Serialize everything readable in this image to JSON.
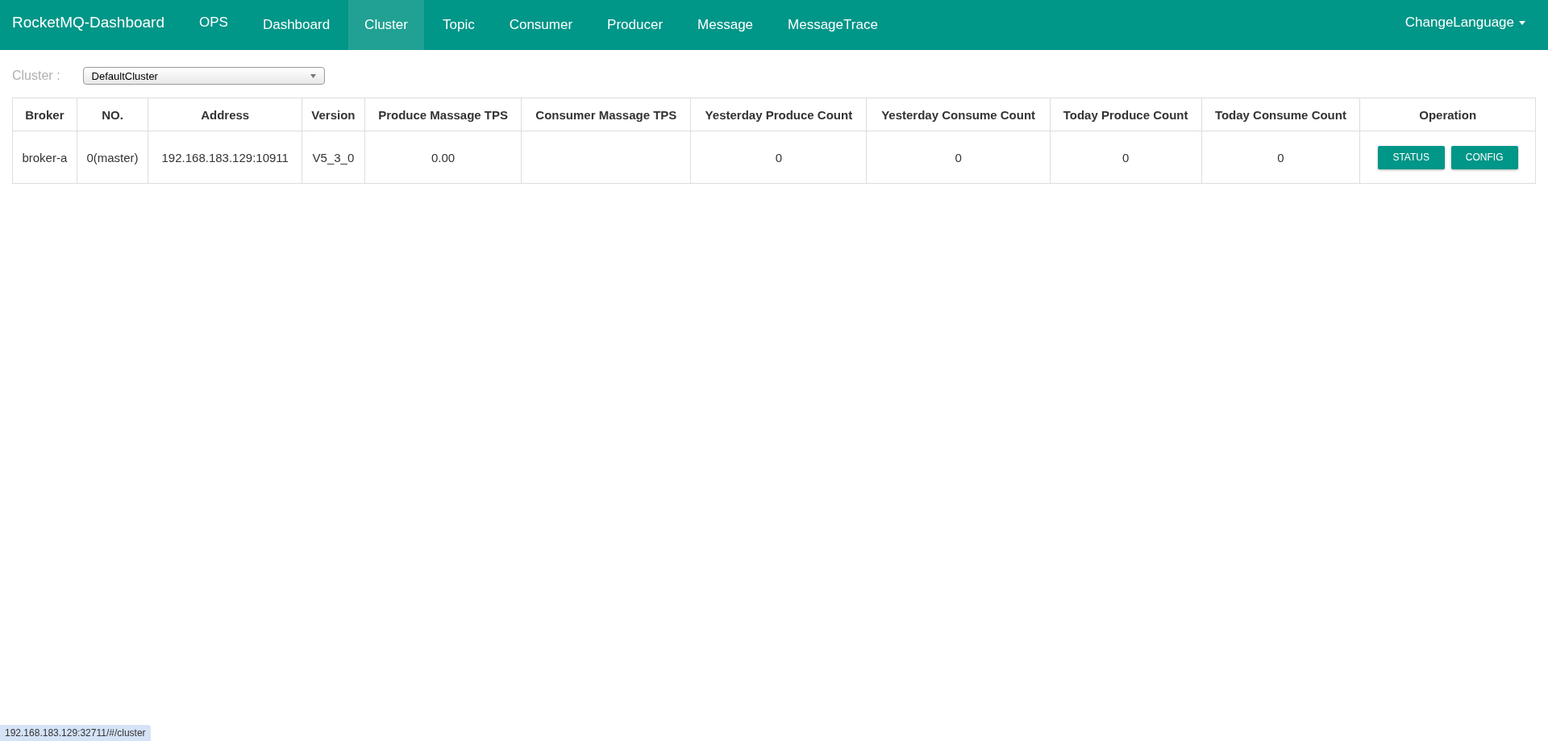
{
  "navbar": {
    "brand": "RocketMQ-Dashboard",
    "items": [
      {
        "label": "OPS",
        "selected": false
      },
      {
        "label": "Dashboard",
        "selected": false
      },
      {
        "label": "Cluster",
        "selected": true
      },
      {
        "label": "Topic",
        "selected": false
      },
      {
        "label": "Consumer",
        "selected": false
      },
      {
        "label": "Producer",
        "selected": false
      },
      {
        "label": "Message",
        "selected": false
      },
      {
        "label": "MessageTrace",
        "selected": false
      }
    ],
    "language_menu": "ChangeLanguage"
  },
  "cluster_filter": {
    "label": "Cluster :",
    "value": "DefaultCluster"
  },
  "table": {
    "columns": [
      "Broker",
      "NO.",
      "Address",
      "Version",
      "Produce Massage TPS",
      "Consumer Massage TPS",
      "Yesterday Produce Count",
      "Yesterday Consume Count",
      "Today Produce Count",
      "Today Consume Count",
      "Operation"
    ],
    "rows": [
      {
        "cells": [
          "broker-a",
          "0(master)",
          "192.168.183.129:10911",
          "V5_3_0",
          "0.00",
          "",
          "0",
          "0",
          "0",
          "0"
        ],
        "buttons": [
          "STATUS",
          "CONFIG"
        ]
      }
    ]
  },
  "status_bar": "192.168.183.129:32711/#/cluster"
}
